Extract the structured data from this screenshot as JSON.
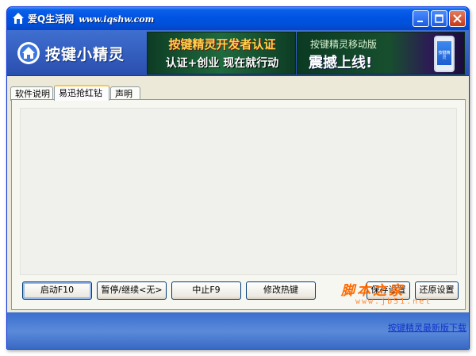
{
  "window": {
    "title": "爱Q生活网",
    "title_url": "www.iqshw.com"
  },
  "header": {
    "logo_text": "按键小精灵",
    "banner1": {
      "line1": "按键精灵开发者认证",
      "line2": "认证+创业 现在就行动"
    },
    "banner2": {
      "line1": "按键精灵移动版",
      "line2": "震撼上线!",
      "phone_text": "按键精灵"
    }
  },
  "tabs": [
    {
      "label": "软件说明"
    },
    {
      "label": "易迅抢红钻"
    },
    {
      "label": "声明"
    }
  ],
  "buttons": {
    "start": "启动F10",
    "pause": "暂停/继续<无>",
    "stop": "中止F9",
    "hotkey": "修改热键",
    "save": "保存设置",
    "restore": "还原设置"
  },
  "footer": {
    "download_link": "按键精灵最新版下载"
  },
  "watermark": {
    "main": "脚本之家",
    "url": "www.jb51.net"
  },
  "colors": {
    "titlebar": "#0054e3",
    "header": "#2a4fae",
    "watermark": "#ff6a00",
    "link": "#1034c8"
  }
}
